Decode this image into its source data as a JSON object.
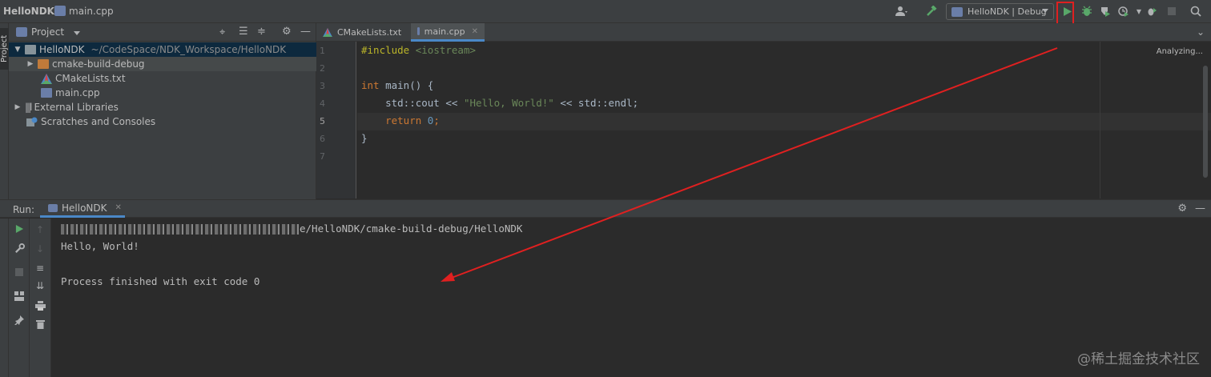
{
  "breadcrumb": {
    "project": "HelloNDK",
    "file": "main.cpp"
  },
  "toolbar": {
    "run_config": "HelloNDK | Debug",
    "icons": [
      "user-icon",
      "build-hammer-icon",
      "run-icon",
      "debug-icon",
      "coverage-icon",
      "profile-icon",
      "attach-icon",
      "stop-icon",
      "search-icon"
    ]
  },
  "project_panel": {
    "title": "Project",
    "side_tab": "Project",
    "tree": [
      {
        "label": "HelloNDK",
        "path": "~/CodeSpace/NDK_Workspace/HelloNDK"
      },
      {
        "label": "cmake-build-debug"
      },
      {
        "label": "CMakeLists.txt"
      },
      {
        "label": "main.cpp"
      },
      {
        "label": "External Libraries"
      },
      {
        "label": "Scratches and Consoles"
      }
    ]
  },
  "editor": {
    "tabs": [
      {
        "label": "CMakeLists.txt"
      },
      {
        "label": "main.cpp"
      }
    ],
    "status": "Analyzing...",
    "line_numbers": [
      "1",
      "2",
      "3",
      "4",
      "5",
      "6",
      "7"
    ],
    "code": {
      "l1_pre": "#include",
      "l1_inc": " <iostream>",
      "l3_kw": "int",
      "l3_rest": " main() {",
      "l4_a": "    std::cout << ",
      "l4_str": "\"Hello, World!\"",
      "l4_b": " << std::endl;",
      "l5_kw": "    return ",
      "l5_num": "0",
      "l5_end": ";",
      "l6": "}"
    }
  },
  "run_panel": {
    "label": "Run:",
    "tab": "HelloNDK",
    "console": {
      "path_tail": "e/HelloNDK/cmake-build-debug/HelloNDK",
      "output": "Hello, World!",
      "exit": "Process finished with exit code 0"
    }
  },
  "watermark": "@稀土掘金技术社区",
  "colors": {
    "accent": "#4a88c7",
    "annotation": "#e02020",
    "run_green": "#59a869"
  }
}
